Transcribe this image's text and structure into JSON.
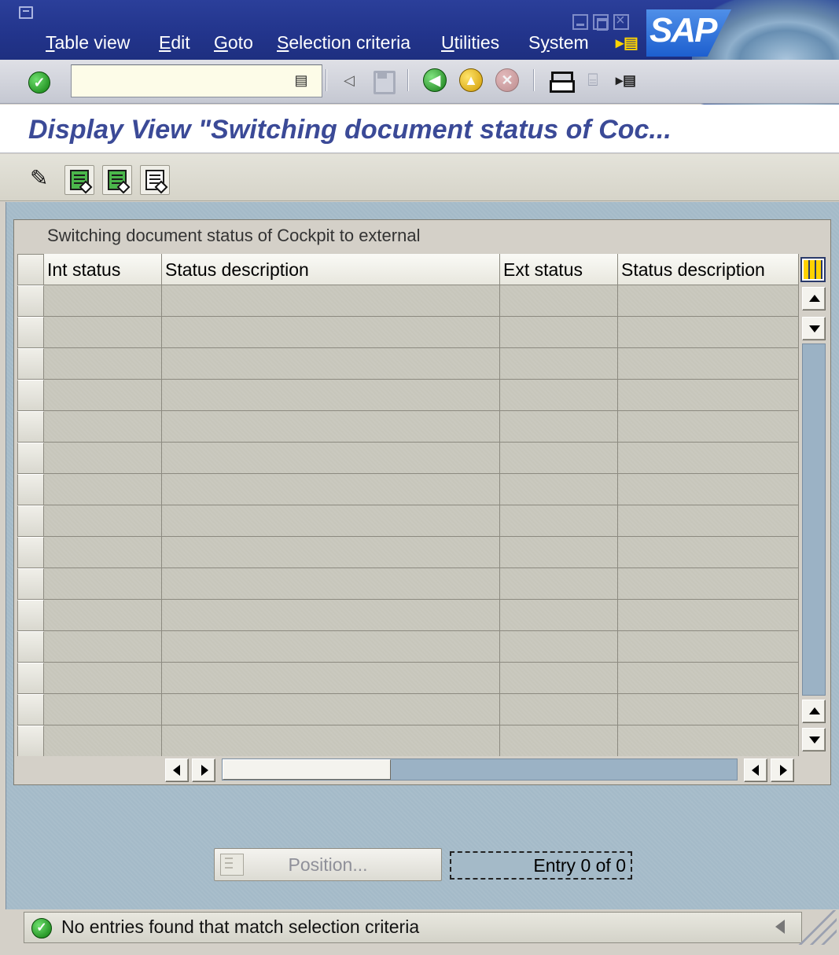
{
  "menu": {
    "items": [
      {
        "label": "Table view",
        "accel": "T"
      },
      {
        "label": "Edit",
        "accel": "E"
      },
      {
        "label": "Goto",
        "accel": "G"
      },
      {
        "label": "Selection criteria",
        "accel": "S"
      },
      {
        "label": "Utilities",
        "accel": "U"
      },
      {
        "label": "System",
        "accel": "y"
      }
    ],
    "logo_text": "SAP"
  },
  "toolbar": {
    "command_value": "",
    "icons": [
      "enter-icon",
      "command-dropdown-icon",
      "back-nav-icon",
      "save-icon",
      "back-icon",
      "exit-icon",
      "cancel-icon",
      "print-icon",
      "find-icon",
      "layout-icon"
    ]
  },
  "title": {
    "text": "Display View \"Switching document status of Coc..."
  },
  "app_toolbar": {
    "icons": [
      "edit-pencil-icon",
      "select-all-icon",
      "select-block-icon",
      "deselect-all-icon"
    ]
  },
  "table": {
    "title": "Switching document status of Cockpit to external",
    "columns": [
      "Int status",
      "Status description",
      "Ext status",
      "Status description"
    ],
    "rows": [],
    "visible_empty_rows": 15
  },
  "position": {
    "button_label": "Position...",
    "entry_label": "Entry 0 of 0"
  },
  "status": {
    "message": "No entries found that match selection criteria",
    "type": "success"
  },
  "colors": {
    "menubar": "#22348b",
    "title_text": "#3b4a97",
    "main_bg": "#a4bac8",
    "grid_cell": "#c7c6bb"
  }
}
